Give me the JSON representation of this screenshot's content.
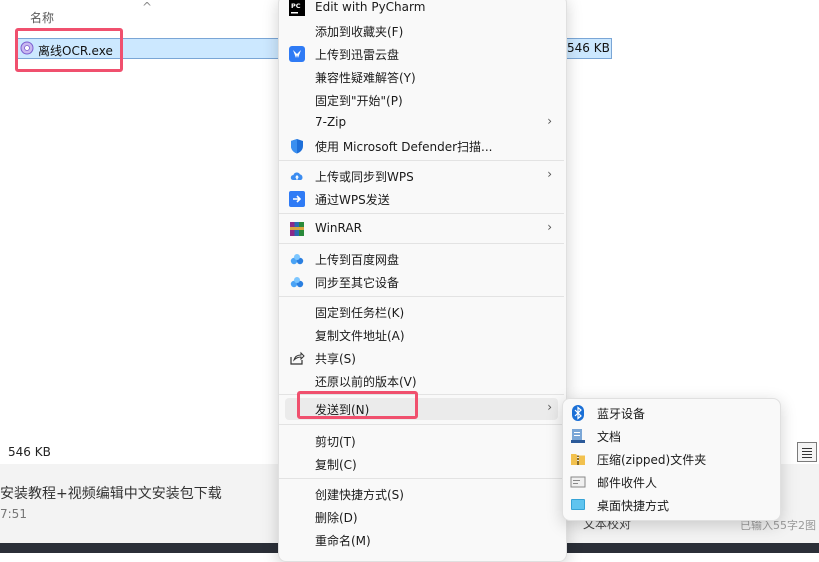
{
  "explorer": {
    "column_header": "名称",
    "file": {
      "name": "离线OCR.exe",
      "size": "546 KB"
    },
    "status_size": "546 KB"
  },
  "editor": {
    "title": "安装教程+视频编辑中文安装包下载",
    "time": "7:51",
    "text_check": "文本校对",
    "word_count": "已输入55字",
    "bottom_right": "2图"
  },
  "menu": {
    "items": [
      {
        "label": "Edit with PyCharm",
        "icon": "pycharm-icon"
      },
      {
        "label": "添加到收藏夹(F)",
        "icon": ""
      },
      {
        "label": "上传到迅雷云盘",
        "icon": "thunder-cloud-icon"
      },
      {
        "label": "兼容性疑难解答(Y)",
        "icon": ""
      },
      {
        "label": "固定到\"开始\"(P)",
        "icon": ""
      },
      {
        "label": "7-Zip",
        "icon": "",
        "submenu": true
      },
      {
        "label": "使用 Microsoft Defender扫描...",
        "icon": "defender-shield-icon"
      },
      {
        "label": "上传或同步到WPS",
        "icon": "wps-cloud-upload-icon",
        "submenu": true
      },
      {
        "label": "通过WPS发送",
        "icon": "wps-send-icon"
      },
      {
        "label": "WinRAR",
        "icon": "winrar-icon",
        "submenu": true
      },
      {
        "label": "上传到百度网盘",
        "icon": "baidu-netdisk-icon"
      },
      {
        "label": "同步至其它设备",
        "icon": "baidu-sync-icon"
      },
      {
        "label": "固定到任务栏(K)",
        "icon": ""
      },
      {
        "label": "复制文件地址(A)",
        "icon": ""
      },
      {
        "label": "共享(S)",
        "icon": "share-icon"
      },
      {
        "label": "还原以前的版本(V)",
        "icon": ""
      },
      {
        "label": "发送到(N)",
        "icon": "",
        "submenu": true
      },
      {
        "label": "剪切(T)",
        "icon": ""
      },
      {
        "label": "复制(C)",
        "icon": ""
      },
      {
        "label": "创建快捷方式(S)",
        "icon": ""
      },
      {
        "label": "删除(D)",
        "icon": ""
      },
      {
        "label": "重命名(M)",
        "icon": ""
      }
    ]
  },
  "sendto": {
    "items": [
      {
        "label": "蓝牙设备",
        "icon": "bluetooth-icon"
      },
      {
        "label": "文档",
        "icon": "documents-icon"
      },
      {
        "label": "压缩(zipped)文件夹",
        "icon": "zip-folder-icon"
      },
      {
        "label": "邮件收件人",
        "icon": "mail-recipient-icon"
      },
      {
        "label": "桌面快捷方式",
        "icon": "desktop-shortcut-icon"
      }
    ]
  },
  "colors": {
    "selection": "#cce8ff",
    "highlight": "#f0506e",
    "menu_bg": "#f9f9f9"
  }
}
